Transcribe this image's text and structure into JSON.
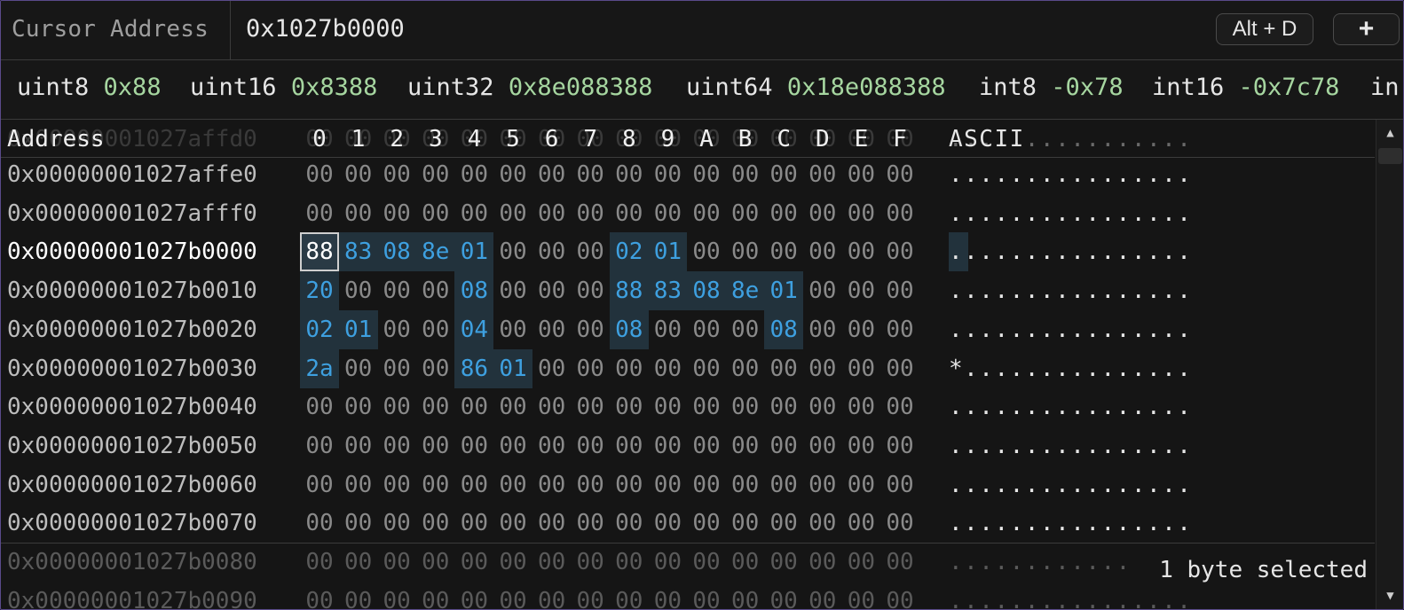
{
  "topbar": {
    "label": "Cursor Address",
    "address": "0x1027b0000",
    "shortcut_label": "Alt + D",
    "add_label": "+"
  },
  "inspector": [
    {
      "type": "uint8",
      "value": "0x88"
    },
    {
      "type": "uint16",
      "value": "0x8388"
    },
    {
      "type": "uint32",
      "value": "0x8e088388"
    },
    {
      "type": "uint64",
      "value": "0x18e088388"
    },
    {
      "type": "int8",
      "value": "-0x78"
    },
    {
      "type": "int16",
      "value": "-0x7c78"
    },
    {
      "type": "in",
      "value": ""
    }
  ],
  "hex": {
    "header_address": "Address",
    "header_cols": [
      "0",
      "1",
      "2",
      "3",
      "4",
      "5",
      "6",
      "7",
      "8",
      "9",
      "A",
      "B",
      "C",
      "D",
      "E",
      "F"
    ],
    "header_ascii": "ASCII",
    "ghost_row": {
      "address": "0x00000001027affd0",
      "ascii": "................"
    },
    "rows": [
      {
        "address": "0x00000001027affe0",
        "bytes": [
          "00",
          "00",
          "00",
          "00",
          "00",
          "00",
          "00",
          "00",
          "00",
          "00",
          "00",
          "00",
          "00",
          "00",
          "00",
          "00"
        ],
        "ascii": "................"
      },
      {
        "address": "0x00000001027afff0",
        "bytes": [
          "00",
          "00",
          "00",
          "00",
          "00",
          "00",
          "00",
          "00",
          "00",
          "00",
          "00",
          "00",
          "00",
          "00",
          "00",
          "00"
        ],
        "ascii": "................"
      },
      {
        "address": "0x00000001027b0000",
        "bytes": [
          "88",
          "83",
          "08",
          "8e",
          "01",
          "00",
          "00",
          "00",
          "02",
          "01",
          "00",
          "00",
          "00",
          "00",
          "00",
          "00"
        ],
        "ascii": "................"
      },
      {
        "address": "0x00000001027b0010",
        "bytes": [
          "20",
          "00",
          "00",
          "00",
          "08",
          "00",
          "00",
          "00",
          "88",
          "83",
          "08",
          "8e",
          "01",
          "00",
          "00",
          "00"
        ],
        "ascii": "................"
      },
      {
        "address": "0x00000001027b0020",
        "bytes": [
          "02",
          "01",
          "00",
          "00",
          "04",
          "00",
          "00",
          "00",
          "08",
          "00",
          "00",
          "00",
          "08",
          "00",
          "00",
          "00"
        ],
        "ascii": "................"
      },
      {
        "address": "0x00000001027b0030",
        "bytes": [
          "2a",
          "00",
          "00",
          "00",
          "86",
          "01",
          "00",
          "00",
          "00",
          "00",
          "00",
          "00",
          "00",
          "00",
          "00",
          "00"
        ],
        "ascii": "*..............."
      },
      {
        "address": "0x00000001027b0040",
        "bytes": [
          "00",
          "00",
          "00",
          "00",
          "00",
          "00",
          "00",
          "00",
          "00",
          "00",
          "00",
          "00",
          "00",
          "00",
          "00",
          "00"
        ],
        "ascii": "................"
      },
      {
        "address": "0x00000001027b0050",
        "bytes": [
          "00",
          "00",
          "00",
          "00",
          "00",
          "00",
          "00",
          "00",
          "00",
          "00",
          "00",
          "00",
          "00",
          "00",
          "00",
          "00"
        ],
        "ascii": "................"
      },
      {
        "address": "0x00000001027b0060",
        "bytes": [
          "00",
          "00",
          "00",
          "00",
          "00",
          "00",
          "00",
          "00",
          "00",
          "00",
          "00",
          "00",
          "00",
          "00",
          "00",
          "00"
        ],
        "ascii": "................"
      },
      {
        "address": "0x00000001027b0070",
        "bytes": [
          "00",
          "00",
          "00",
          "00",
          "00",
          "00",
          "00",
          "00",
          "00",
          "00",
          "00",
          "00",
          "00",
          "00",
          "00",
          "00"
        ],
        "ascii": "................"
      },
      {
        "address": "0x00000001027b0080",
        "bytes": [
          "00",
          "00",
          "00",
          "00",
          "00",
          "00",
          "00",
          "00",
          "00",
          "00",
          "00",
          "00",
          "00",
          "00",
          "00",
          "00"
        ],
        "ascii": "............"
      },
      {
        "address": "0x00000001027b0090",
        "bytes": [
          "00",
          "00",
          "00",
          "00",
          "00",
          "00",
          "00",
          "00",
          "00",
          "00",
          "00",
          "00",
          "00",
          "00",
          "00",
          "00"
        ],
        "ascii": "................"
      }
    ],
    "highlight": [
      [],
      [],
      [
        0,
        1,
        2,
        3,
        4,
        8,
        9
      ],
      [
        0,
        4,
        8,
        9,
        10,
        11,
        12
      ],
      [
        0,
        1,
        4,
        8,
        12
      ],
      [
        0,
        4,
        5
      ],
      [],
      [],
      [],
      [],
      [],
      []
    ],
    "cursor": {
      "row": 2,
      "col": 0
    }
  },
  "status": {
    "selection": "1 byte selected"
  },
  "colors": {
    "accent": "#3ea0e0",
    "value_green": "#a6d6a0",
    "border": "#5a4a8a"
  }
}
